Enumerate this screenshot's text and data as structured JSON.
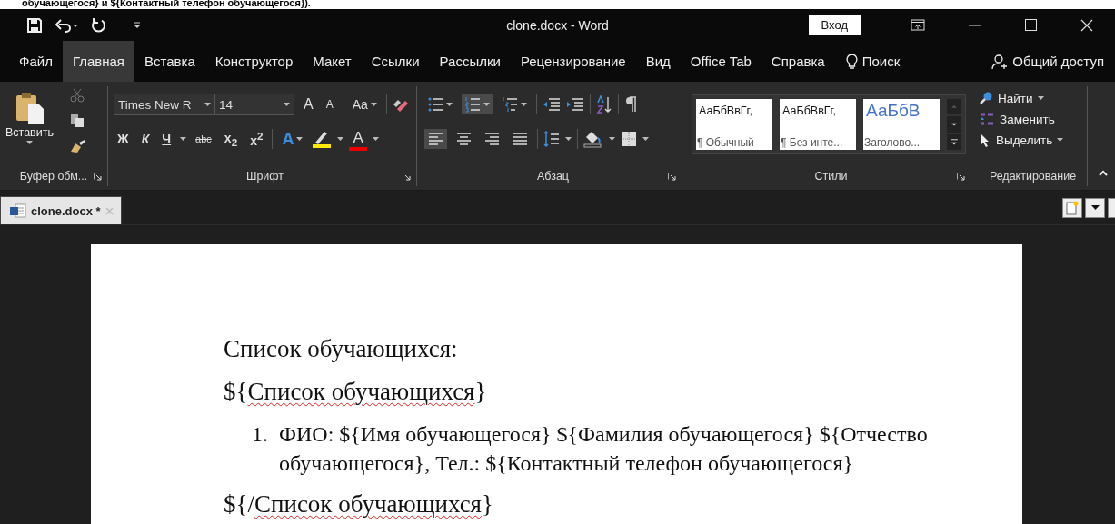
{
  "page_header_fragment": "обучающегося} и ${Контактный телефон обучающегося}).",
  "window": {
    "title": "clone.docx  -  Word",
    "sign_in": "Вход"
  },
  "menu_tabs": [
    {
      "label": "Файл",
      "selected": false
    },
    {
      "label": "Главная",
      "selected": true
    },
    {
      "label": "Вставка",
      "selected": false
    },
    {
      "label": "Конструктор",
      "selected": false
    },
    {
      "label": "Макет",
      "selected": false
    },
    {
      "label": "Ссылки",
      "selected": false
    },
    {
      "label": "Рассылки",
      "selected": false
    },
    {
      "label": "Рецензирование",
      "selected": false
    },
    {
      "label": "Вид",
      "selected": false
    },
    {
      "label": "Office Tab",
      "selected": false
    },
    {
      "label": "Справка",
      "selected": false
    }
  ],
  "search": {
    "label": "Поиск"
  },
  "share": {
    "label": "Общий доступ"
  },
  "ribbon": {
    "clipboard": {
      "paste": "Вставить",
      "group_label": "Буфер обм..."
    },
    "font": {
      "font_name": "Times New R",
      "font_size": "14",
      "grow": "A",
      "shrink": "A",
      "change_case": "Aa",
      "format_buttons": [
        {
          "kind": "bold",
          "label": "Ж"
        },
        {
          "kind": "italic",
          "label": "К"
        },
        {
          "kind": "underline",
          "label": "Ч"
        },
        {
          "kind": "strike",
          "label": "abc"
        },
        {
          "kind": "sub",
          "label": "x$_{2}$"
        },
        {
          "kind": "sup",
          "label": "x$^{2}$"
        }
      ],
      "effects": "A",
      "font_color": "A",
      "group_label": "Шрифт"
    },
    "paragraph": {
      "lists": [
        {
          "kind": "bullets",
          "selected": false
        },
        {
          "kind": "numbering",
          "selected": true
        },
        {
          "kind": "multilevel",
          "selected": false
        }
      ],
      "alignment": [
        {
          "kind": "left",
          "selected": true
        },
        {
          "kind": "center",
          "selected": false
        },
        {
          "kind": "right",
          "selected": false
        },
        {
          "kind": "justify",
          "selected": false
        }
      ],
      "group_label": "Абзац"
    },
    "styles": {
      "items": [
        {
          "preview": "АаБбВвГг,",
          "name": "¶ Обычный",
          "kind": "normal"
        },
        {
          "preview": "АаБбВвГг,",
          "name": "¶ Без инте...",
          "kind": "normal"
        },
        {
          "preview": "АаБбВ",
          "name": "Заголово...",
          "kind": "heading"
        }
      ],
      "group_label": "Стили"
    },
    "editing": {
      "items": [
        {
          "kind": "find",
          "label": "Найти"
        },
        {
          "kind": "replace",
          "label": "Заменить"
        },
        {
          "kind": "select",
          "label": "Выделить"
        }
      ],
      "group_label": "Редактирование"
    }
  },
  "doc_tabs": [
    {
      "label": "clone.docx *",
      "selected": true
    }
  ],
  "document": {
    "blocks": [
      {
        "kind": "paragraph",
        "segments": [
          {
            "text": "Список обучающихся:",
            "misspelled": false
          }
        ]
      },
      {
        "kind": "paragraph",
        "segments": [
          {
            "text": "${",
            "misspelled": false
          },
          {
            "text": "Список обучающихся",
            "misspelled": true
          },
          {
            "text": "}",
            "misspelled": false
          }
        ]
      },
      {
        "kind": "list_item",
        "number": "1.",
        "segments": [
          {
            "text": "ФИО: ${Имя обучающегося} ${Фамилия обучающегося} ${Отчество обучающегося}, Тел.: ${Контактный телефон обучающегося}",
            "misspelled": false
          }
        ]
      },
      {
        "kind": "paragraph",
        "segments": [
          {
            "text": "${/",
            "misspelled": false
          },
          {
            "text": "Список обучающихся",
            "misspelled": true
          },
          {
            "text": "}",
            "misspelled": false
          }
        ]
      }
    ]
  }
}
